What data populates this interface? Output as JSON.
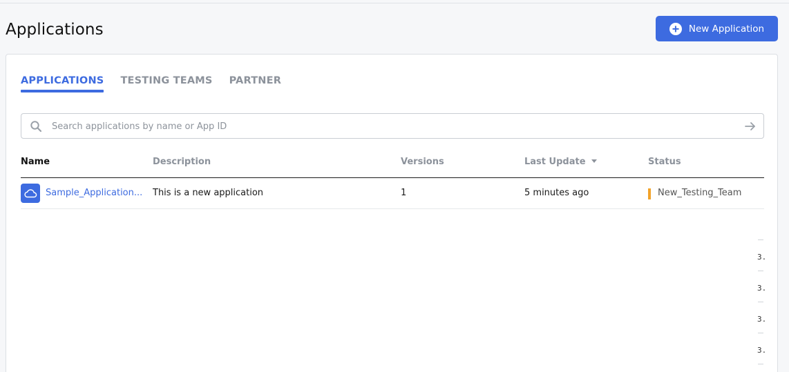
{
  "header": {
    "title": "Applications",
    "new_button_label": "New Application"
  },
  "tabs": [
    {
      "label": "APPLICATIONS",
      "active": true
    },
    {
      "label": "TESTING TEAMS",
      "active": false
    },
    {
      "label": "PARTNER",
      "active": false
    }
  ],
  "search": {
    "placeholder": "Search applications by name or App ID",
    "value": ""
  },
  "table": {
    "columns": [
      "Name",
      "Description",
      "Versions",
      "Last Update",
      "Status"
    ],
    "sorted_column": "Last Update",
    "rows": [
      {
        "name": "Sample_Application...",
        "description": "This is a new application",
        "versions": "1",
        "last_update": "5 minutes ago",
        "status": "New_Testing_Team"
      }
    ]
  },
  "side_fragments": [
    "3.",
    "3.",
    "3.",
    "3."
  ],
  "colors": {
    "accent": "#3d6be0",
    "status_bar": "#f2a32a"
  },
  "icons": [
    "plus-circle-icon",
    "search-icon",
    "arrow-right-icon",
    "sort-down-icon",
    "cloud-icon"
  ]
}
